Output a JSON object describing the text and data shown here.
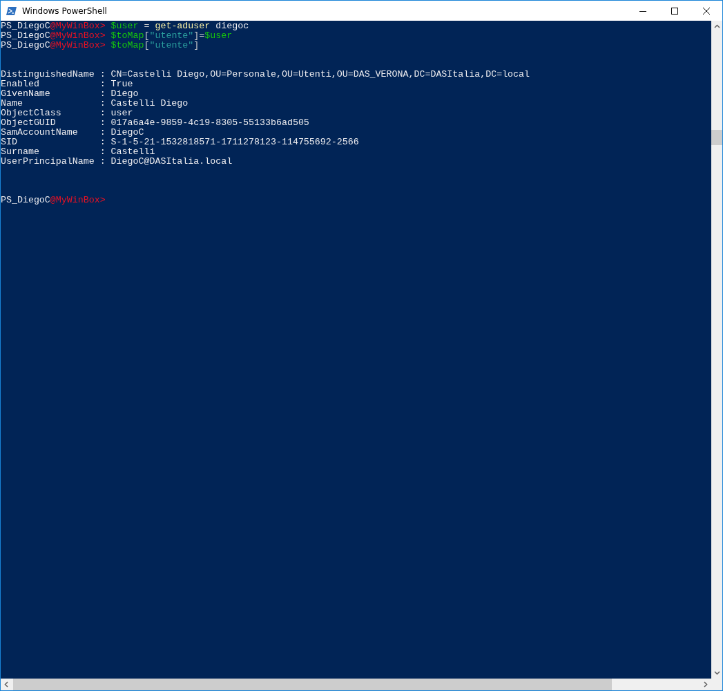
{
  "window": {
    "title": "Windows PowerShell"
  },
  "console": {
    "commands": [
      [
        {
          "kind": "prompt",
          "text": "PS_DiegoC"
        },
        {
          "kind": "host",
          "text": "@MyWinBox>"
        },
        {
          "kind": "variable",
          "text": "$user"
        },
        {
          "kind": "operator",
          "text": " = "
        },
        {
          "kind": "command",
          "text": "get-aduser"
        },
        {
          "kind": "plain",
          "text": " diegoc"
        }
      ],
      [
        {
          "kind": "prompt",
          "text": "PS_DiegoC"
        },
        {
          "kind": "host",
          "text": "@MyWinBox>"
        },
        {
          "kind": "variable",
          "text": "$toMap"
        },
        {
          "kind": "operator",
          "text": "["
        },
        {
          "kind": "string",
          "text": "\"utente\""
        },
        {
          "kind": "operator",
          "text": "]="
        },
        {
          "kind": "variable",
          "text": "$user"
        }
      ],
      [
        {
          "kind": "prompt",
          "text": "PS_DiegoC"
        },
        {
          "kind": "host",
          "text": "@MyWinBox>"
        },
        {
          "kind": "variable",
          "text": "$toMap"
        },
        {
          "kind": "operator",
          "text": "["
        },
        {
          "kind": "string",
          "text": "\"utente\""
        },
        {
          "kind": "operator",
          "text": "]"
        }
      ]
    ],
    "output": [
      "DistinguishedName : CN=Castelli Diego,OU=Personale,OU=Utenti,OU=DAS_VERONA,DC=DASItalia,DC=local",
      "Enabled           : True",
      "GivenName         : Diego",
      "Name              : Castelli Diego",
      "ObjectClass       : user",
      "ObjectGUID        : 017a6a4e-9859-4c19-8305-55133b6ad505",
      "SamAccountName    : DiegoC",
      "SID               : S-1-5-21-1532818571-1711278123-114755692-2566",
      "Surname           : Castelli",
      "UserPrincipalName : DiegoC@DASItalia.local"
    ],
    "prompt": [
      {
        "kind": "prompt",
        "text": "PS_DiegoC"
      },
      {
        "kind": "host",
        "text": "@MyWinBox>"
      }
    ]
  }
}
